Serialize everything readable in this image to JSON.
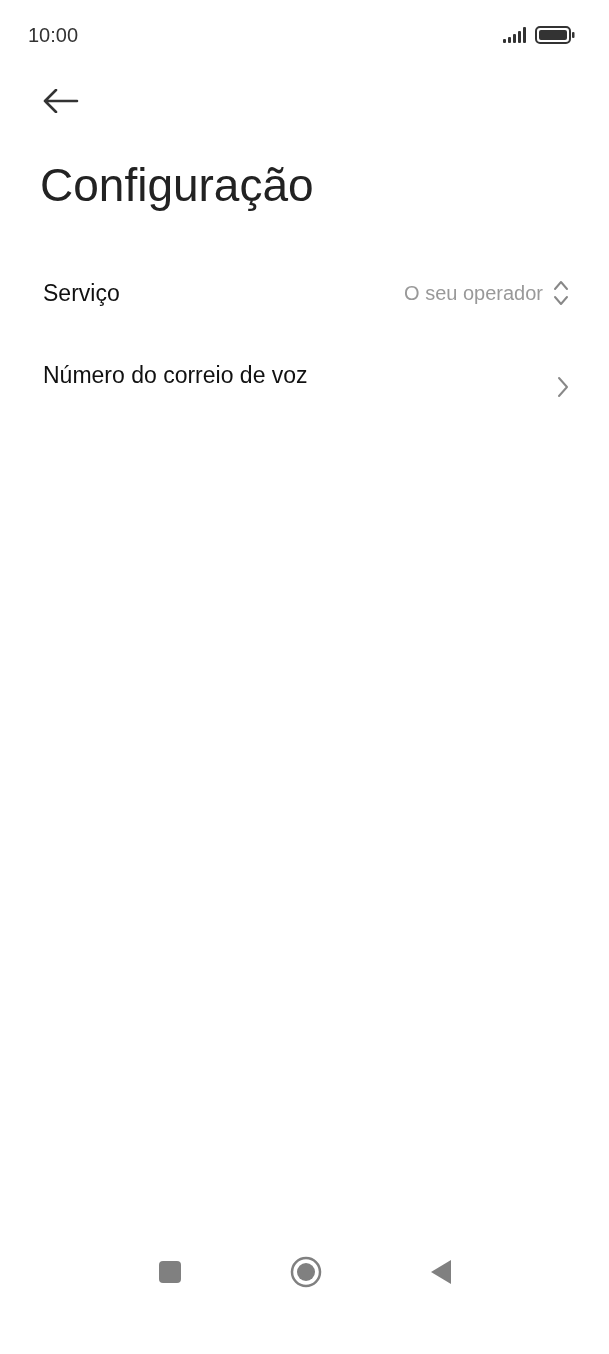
{
  "status_bar": {
    "time": "10:00"
  },
  "title": "Configuração",
  "settings": [
    {
      "kind": "select",
      "label": "Serviço",
      "value": "O seu operador"
    },
    {
      "kind": "link",
      "label": "Número do correio de voz"
    }
  ]
}
